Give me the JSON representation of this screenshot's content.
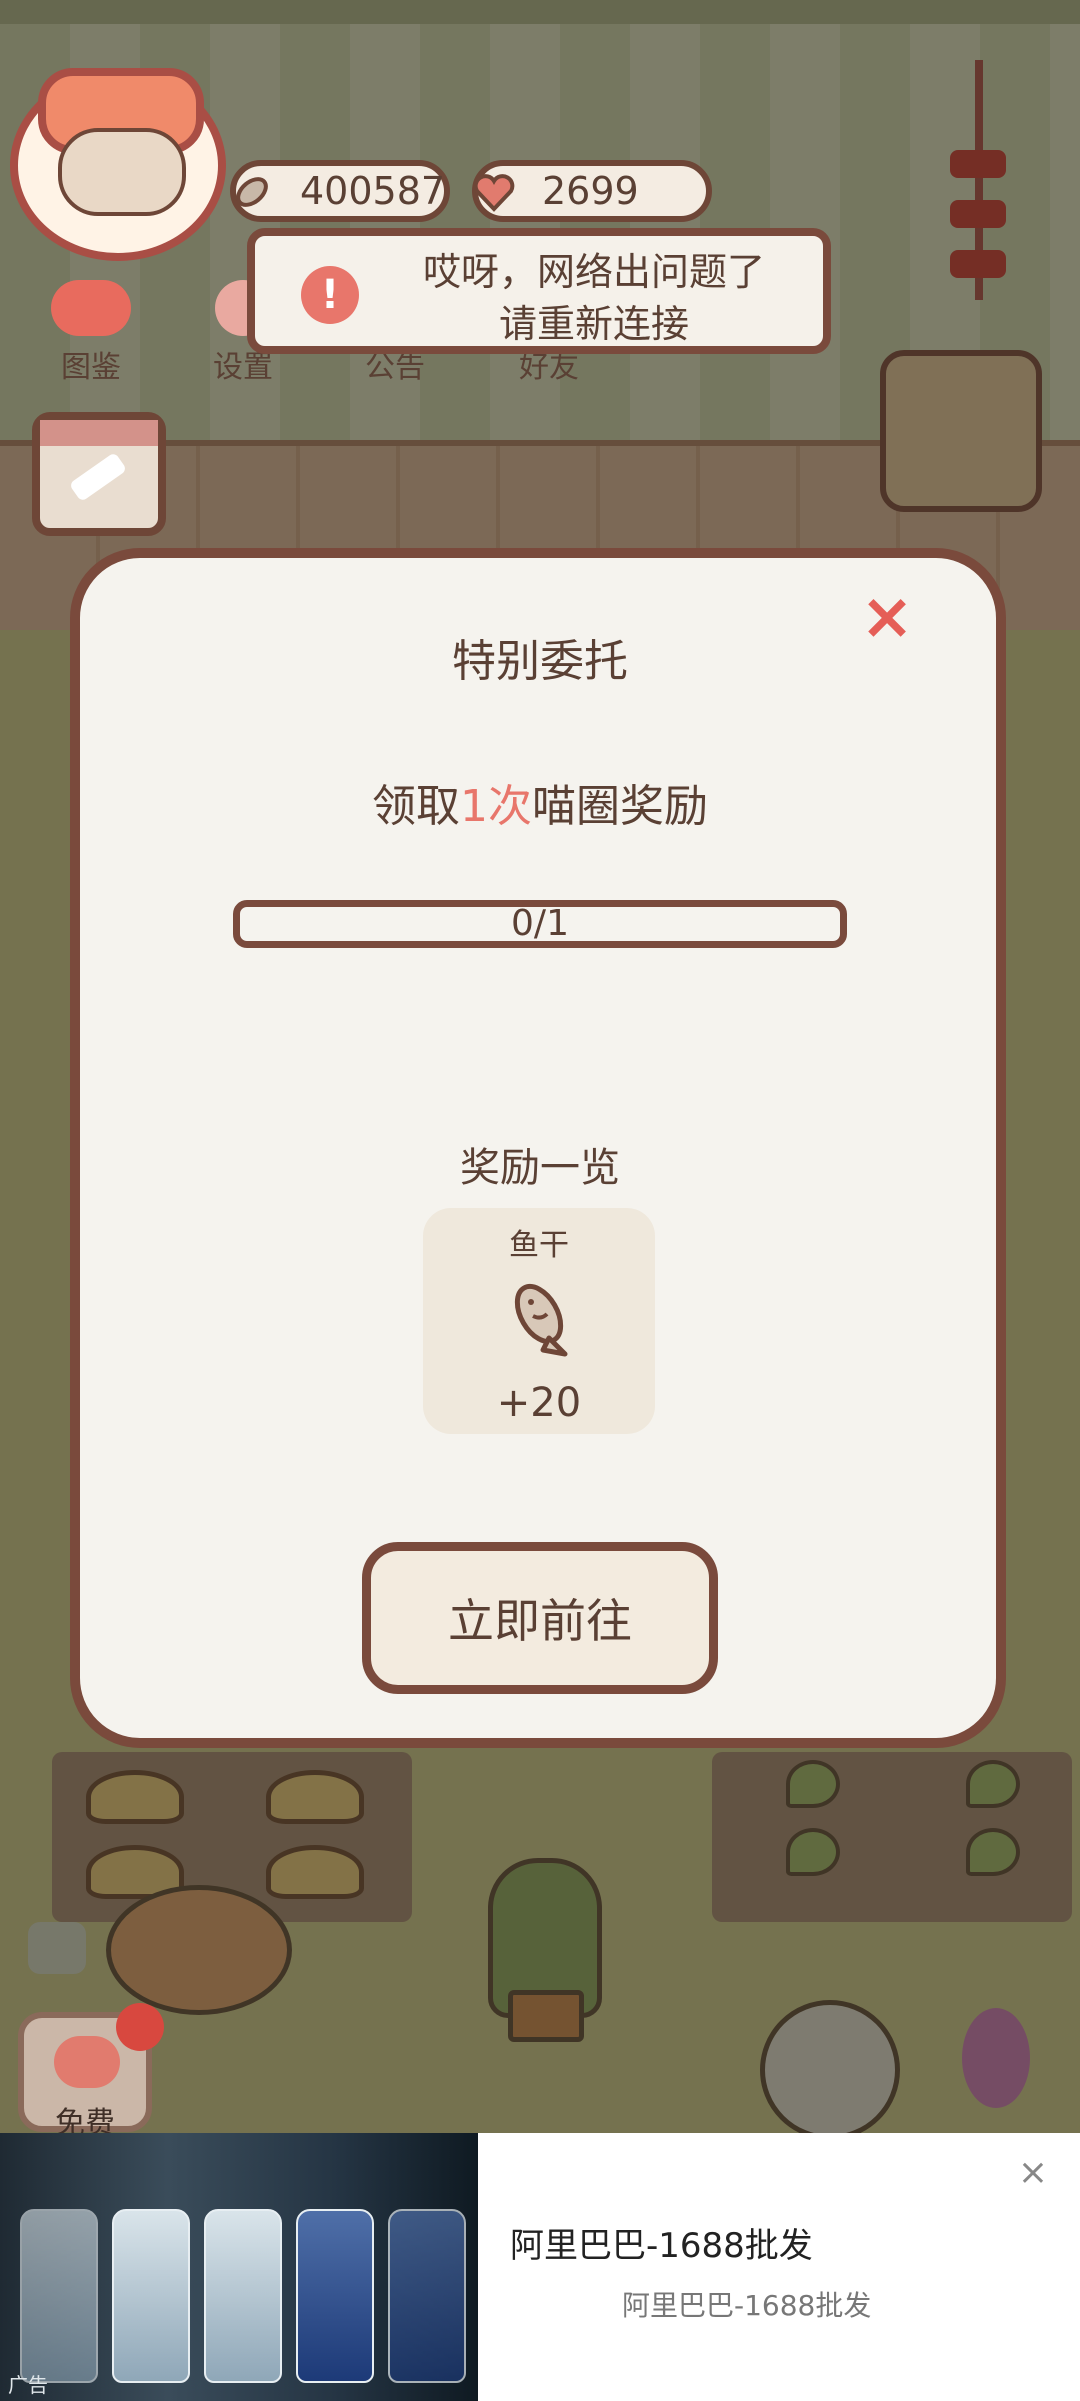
{
  "hud": {
    "fish_count": "400587",
    "heart_count": "2699",
    "toolbar": [
      {
        "label": "图鉴"
      },
      {
        "label": "设置"
      },
      {
        "label": "公告"
      },
      {
        "label": "好友"
      }
    ]
  },
  "toast": {
    "icon": "!",
    "message_line1": "哎呀，网络出问题了",
    "message_line2": "请重新连接"
  },
  "modal": {
    "title": "特别委托",
    "task_prefix": "领取",
    "task_highlight": "1次",
    "task_suffix": "喵圈奖励",
    "progress_text": "0/1",
    "progress_fraction": 0,
    "reward_heading": "奖励一览",
    "reward": {
      "name": "鱼干",
      "icon": "fish-icon",
      "amount": "+20"
    },
    "go_button": "立即前往",
    "close_icon": "×"
  },
  "free_button": {
    "label": "免费"
  },
  "ad": {
    "tag": "广告",
    "title": "阿里巴巴-1688批发",
    "subtitle": "阿里巴巴-1688批发",
    "close_icon": "×"
  },
  "colors": {
    "accent": "#e8766b",
    "border": "#7a4a3c",
    "text": "#5a4034",
    "panel": "#f5f3ee"
  }
}
